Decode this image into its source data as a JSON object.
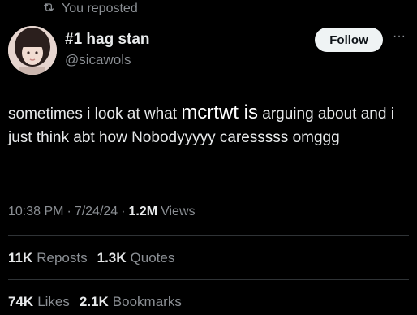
{
  "repost": {
    "label": "You reposted",
    "icon": "repost-icon"
  },
  "author": {
    "name": "#1 hag stan",
    "handle": "@sicawols"
  },
  "follow_label": "Follow",
  "tweet": {
    "part1": "sometimes i look at what ",
    "highlight": "mcrtwt is",
    "part2": "  arguing about and i just think abt how Nobodyyyyy caresssss omggg"
  },
  "meta": {
    "time": "10:38 PM",
    "sep1": "·",
    "date": "7/24/24",
    "sep2": "·",
    "views_count": "1.2M",
    "views_label": "Views"
  },
  "stats_row1": [
    {
      "count": "11K",
      "label": "Reposts"
    },
    {
      "count": "1.3K",
      "label": "Quotes"
    }
  ],
  "stats_row2": [
    {
      "count": "74K",
      "label": "Likes"
    },
    {
      "count": "2.1K",
      "label": "Bookmarks"
    }
  ],
  "colors": {
    "background": "#000000",
    "text": "#e7e9ea",
    "secondary": "#8b8f94",
    "follow_bg": "#eff3f4"
  }
}
